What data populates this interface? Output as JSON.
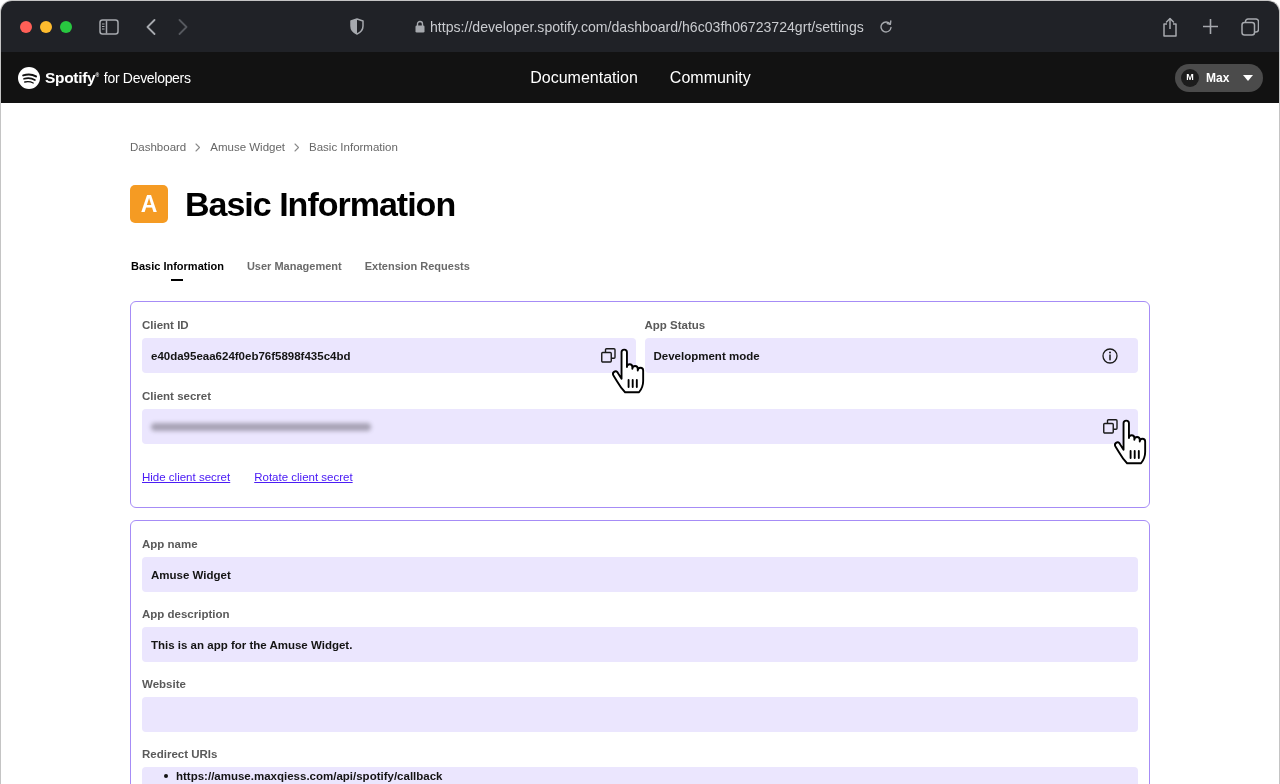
{
  "browser": {
    "nav_buttons": [
      {
        "kind": "back",
        "disabled": false
      },
      {
        "kind": "forward",
        "disabled": true
      }
    ],
    "url": "https://developer.spotify.com/dashboard/h6c03fh06723724grt/settings"
  },
  "site_header": {
    "logo": {
      "brand": "Spotify$^{®}$",
      "suffix": "for Developers"
    },
    "nav": [
      {
        "label": "Documentation"
      },
      {
        "label": "Community"
      }
    ],
    "user": {
      "initial": "M",
      "name": "Max"
    }
  },
  "breadcrumb": [
    {
      "label": "Dashboard"
    },
    {
      "label": "Amuse Widget"
    },
    {
      "label": "Basic Information"
    }
  ],
  "page_header": {
    "app_icon_letter": "A",
    "title": "Basic Information"
  },
  "tabs": [
    {
      "label": "Basic Information",
      "selected": true
    },
    {
      "label": "User Management",
      "selected": false
    },
    {
      "label": "Extension Requests",
      "selected": false
    }
  ],
  "credentials_card": {
    "fields": [
      {
        "kind": "copy",
        "label": "Client ID",
        "value": "e40da95eaa624f0eb76f5898f435c4bd",
        "pointer": true
      },
      {
        "kind": "status",
        "label": "App Status",
        "value": "Development mode",
        "pointer": false
      },
      {
        "kind": "secret",
        "label": "Client secret",
        "pointer": true
      }
    ],
    "links": [
      {
        "label": "Hide client secret"
      },
      {
        "label": "Rotate client secret"
      }
    ]
  },
  "details_card": {
    "fields": [
      {
        "kind": "text",
        "label": "App name",
        "value": "Amuse Widget"
      },
      {
        "kind": "text",
        "label": "App description",
        "value": "This is an app for the Amuse Widget."
      },
      {
        "kind": "text",
        "label": "Website"
      },
      {
        "kind": "list",
        "label": "Redirect URIs",
        "items": [
          "https://amuse.maxqiess.com/api/spotify/callback"
        ]
      }
    ]
  }
}
